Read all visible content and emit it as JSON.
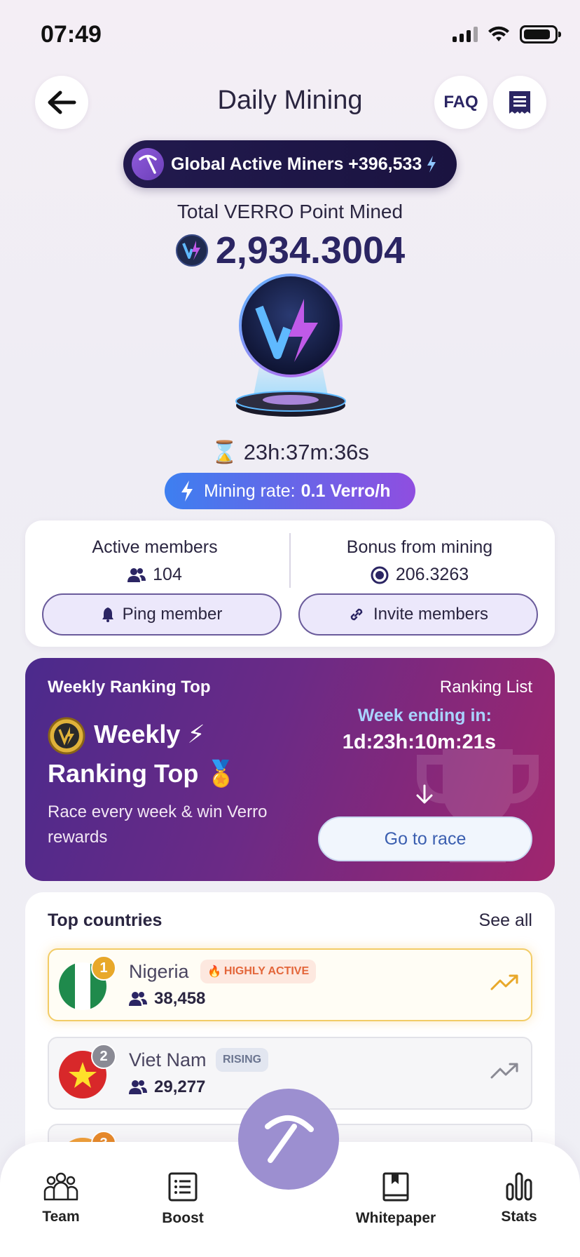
{
  "status_bar": {
    "time": "07:49"
  },
  "header": {
    "title": "Daily Mining",
    "faq_label": "FAQ"
  },
  "miners_pill": {
    "text": "Global Active Miners +396,533"
  },
  "total": {
    "label": "Total VERRO Point Mined",
    "value": "2,934.3004"
  },
  "timer": {
    "value": "23h:37m:36s"
  },
  "rate": {
    "label": "Mining rate:",
    "value": "0.1 Verro/h"
  },
  "members": {
    "active_label": "Active members",
    "active_value": "104",
    "bonus_label": "Bonus from mining",
    "bonus_value": "206.3263",
    "ping_label": "Ping member",
    "invite_label": "Invite members"
  },
  "ranking": {
    "small_title": "Weekly Ranking Top",
    "list_link": "Ranking List",
    "title_line1": "Weekly ⚡",
    "title_line2": "Ranking Top 🏅",
    "description": "Race every week & win Verro rewards",
    "week_label": "Week ending in:",
    "week_value": "1d:23h:10m:21s",
    "button_label": "Go to race"
  },
  "countries": {
    "title": "Top countries",
    "see_all": "See all",
    "items": [
      {
        "rank": "1",
        "name": "Nigeria",
        "count": "38,458",
        "tag": "HIGHLY ACTIVE",
        "rank_color": "#e8a82a"
      },
      {
        "rank": "2",
        "name": "Viet Nam",
        "count": "29,277",
        "tag": "RISING",
        "rank_color": "#8a8a94"
      },
      {
        "rank": "3",
        "rank_color": "#e88a2a"
      }
    ]
  },
  "nav": {
    "team": "Team",
    "boost": "Boost",
    "whitepaper": "Whitepaper",
    "stats": "Stats"
  },
  "colors": {
    "brand_dark": "#2b2563",
    "accent_purple": "#8f4ee0",
    "accent_blue": "#3d7ff0",
    "fab": "#9c8fd0"
  }
}
